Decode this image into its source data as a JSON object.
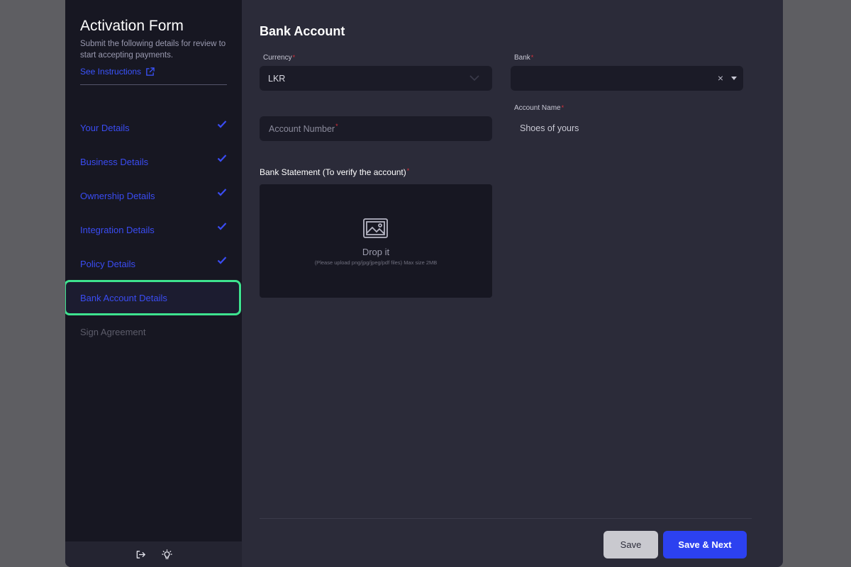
{
  "sidebar": {
    "title": "Activation Form",
    "subtitle": "Submit the following details for review to start accepting payments.",
    "instructions_link": "See Instructions",
    "steps": [
      {
        "label": "Your Details",
        "status": "completed"
      },
      {
        "label": "Business Details",
        "status": "completed"
      },
      {
        "label": "Ownership Details",
        "status": "completed"
      },
      {
        "label": "Integration Details",
        "status": "completed"
      },
      {
        "label": "Policy Details",
        "status": "completed"
      },
      {
        "label": "Bank Account Details",
        "status": "active"
      },
      {
        "label": "Sign Agreement",
        "status": "pending"
      }
    ],
    "footer_icons": [
      "logout-icon",
      "lightbulb-icon"
    ]
  },
  "form": {
    "title": "Bank Account",
    "currency": {
      "label": "Currency",
      "required_mark": "*",
      "value": "LKR"
    },
    "bank": {
      "label": "Bank",
      "required_mark": "*",
      "value": "",
      "clear_glyph": "×"
    },
    "account_number": {
      "placeholder": "Account Number",
      "required_mark": "*"
    },
    "account_name": {
      "label": "Account Name",
      "required_mark": "*",
      "value": "Shoes of yours"
    },
    "bank_statement": {
      "label": "Bank Statement (To verify the account)",
      "required_mark": "*",
      "drop_title": "Drop it",
      "drop_note": "(Please upload png/jpg/jpeg/pdf files) Max size 2MB"
    }
  },
  "actions": {
    "save": "Save",
    "save_next": "Save & Next"
  },
  "colors": {
    "accent": "#2c41f0",
    "step_link": "#3a4cf3",
    "active_outline": "#3ee38f",
    "required": "#d9313b"
  }
}
